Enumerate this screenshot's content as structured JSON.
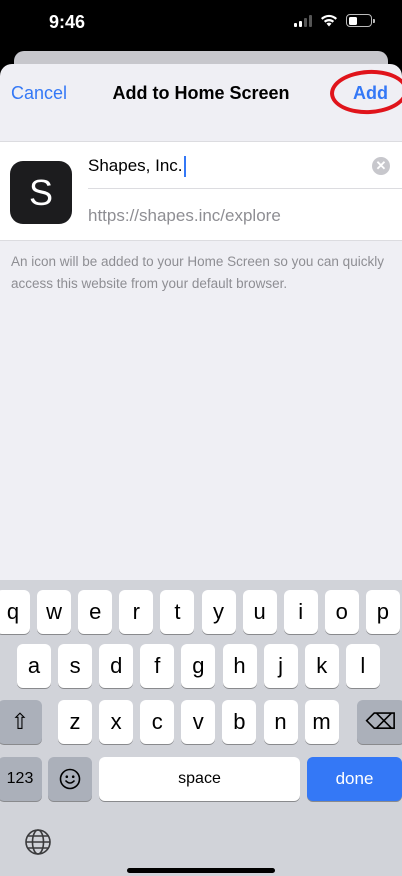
{
  "status": {
    "time": "9:46"
  },
  "nav": {
    "cancel": "Cancel",
    "title": "Add to Home Screen",
    "add": "Add"
  },
  "card": {
    "icon_letter": "S",
    "name_value": "Shapes, Inc.",
    "url": "https://shapes.inc/explore",
    "clear_glyph": "✕"
  },
  "note": "An icon will be added to your Home Screen so you can quickly access this website from your default browser.",
  "keyboard": {
    "row1": [
      "q",
      "w",
      "e",
      "r",
      "t",
      "y",
      "u",
      "i",
      "o",
      "p"
    ],
    "row2": [
      "a",
      "s",
      "d",
      "f",
      "g",
      "h",
      "j",
      "k",
      "l"
    ],
    "row3": [
      "z",
      "x",
      "c",
      "v",
      "b",
      "n",
      "m"
    ],
    "numbers": "123",
    "space": "space",
    "done": "done",
    "shift_glyph": "⇧",
    "delete_glyph": "⌫",
    "emoji_icon": "emoji-icon",
    "globe_icon": "globe-icon"
  },
  "colors": {
    "accent": "#3478f6",
    "annotation": "#e0141b"
  }
}
